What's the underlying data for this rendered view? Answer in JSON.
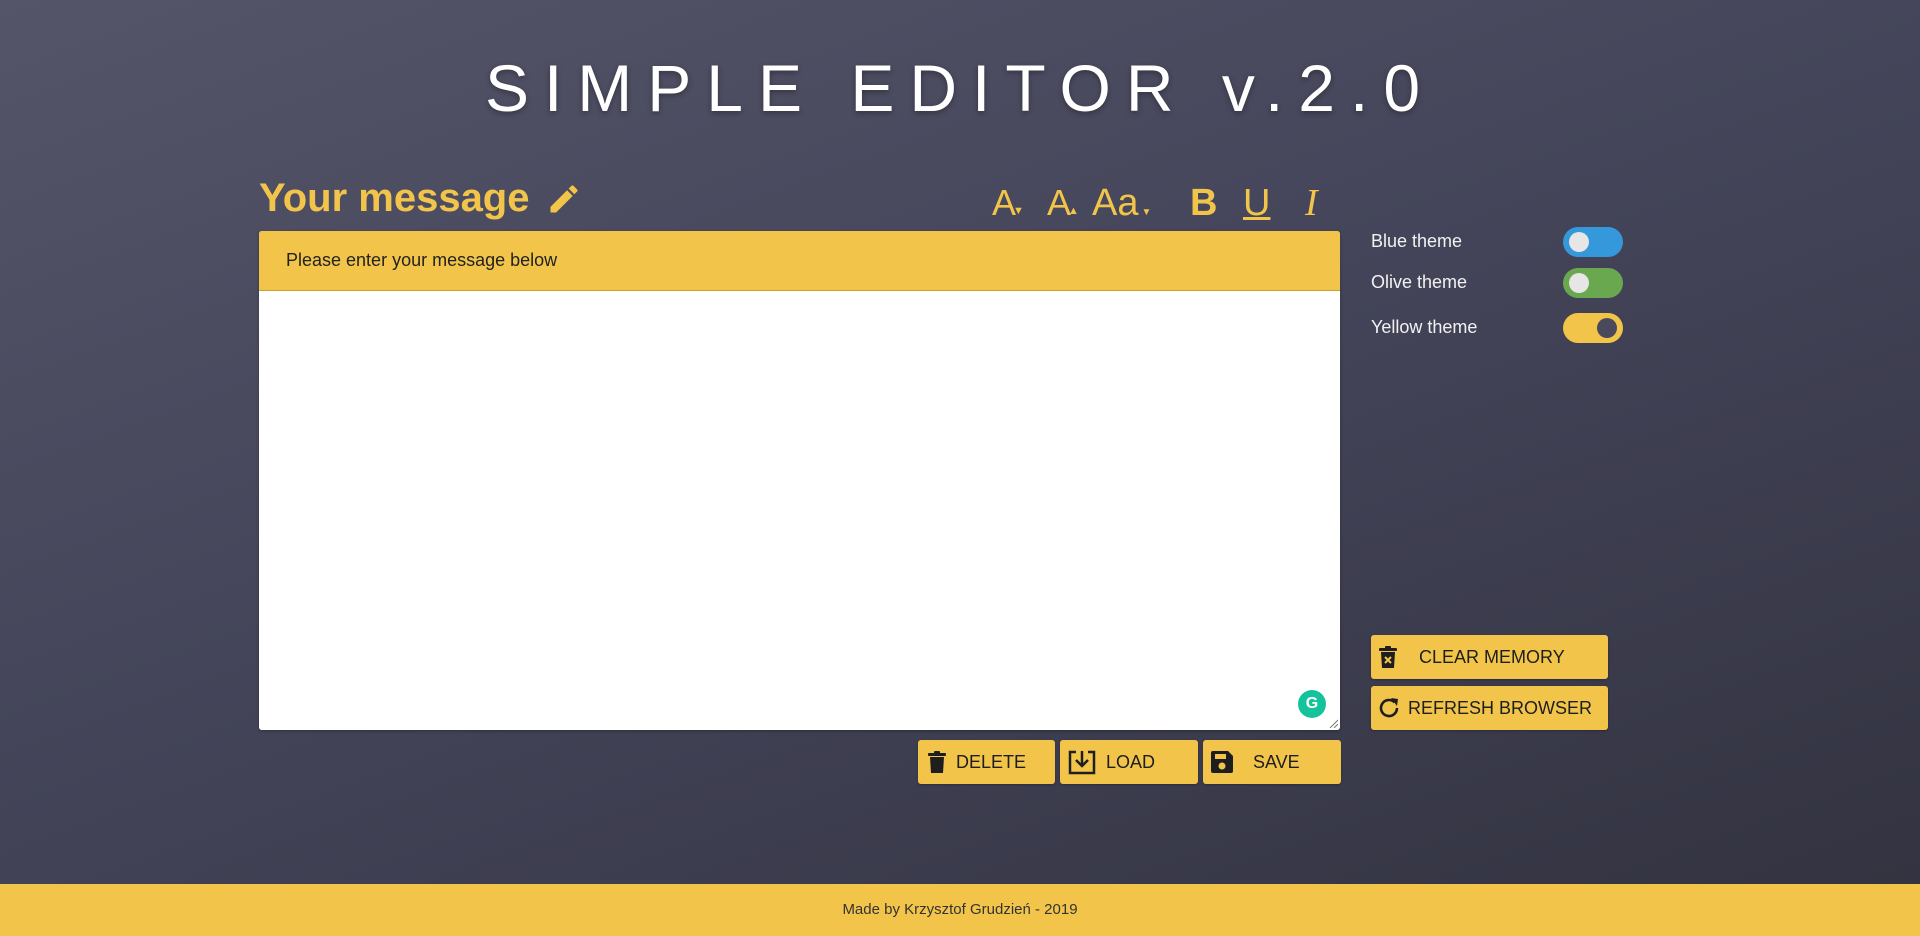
{
  "app": {
    "title": "SIMPLE EDITOR v.2.0"
  },
  "colors": {
    "accent": "#f2c54a",
    "background": "#44455a",
    "blue_toggle": "#3498db",
    "olive_toggle": "#6aa84f",
    "yellow_toggle": "#f2c54a",
    "grammarly": "#15c39a"
  },
  "editor": {
    "heading": "Your message",
    "heading_icon": "pencil-icon",
    "header_text": "Please enter your message below",
    "content": ""
  },
  "toolbar": {
    "font_size_decrease": "A",
    "font_size_increase": "A",
    "font_family": "Aa",
    "bold": "B",
    "underline": "U",
    "italic": "I"
  },
  "actions": {
    "delete_label": "DELETE",
    "load_label": "LOAD",
    "save_label": "SAVE"
  },
  "side_actions": {
    "clear_memory_label": "CLEAR MEMORY",
    "refresh_browser_label": "REFRESH BROWSER"
  },
  "themes": [
    {
      "label": "Blue theme",
      "enabled": false
    },
    {
      "label": "Olive theme",
      "enabled": false
    },
    {
      "label": "Yellow theme",
      "enabled": true
    }
  ],
  "footer": {
    "text": "Made by Krzysztof Grudzień - 2019"
  }
}
